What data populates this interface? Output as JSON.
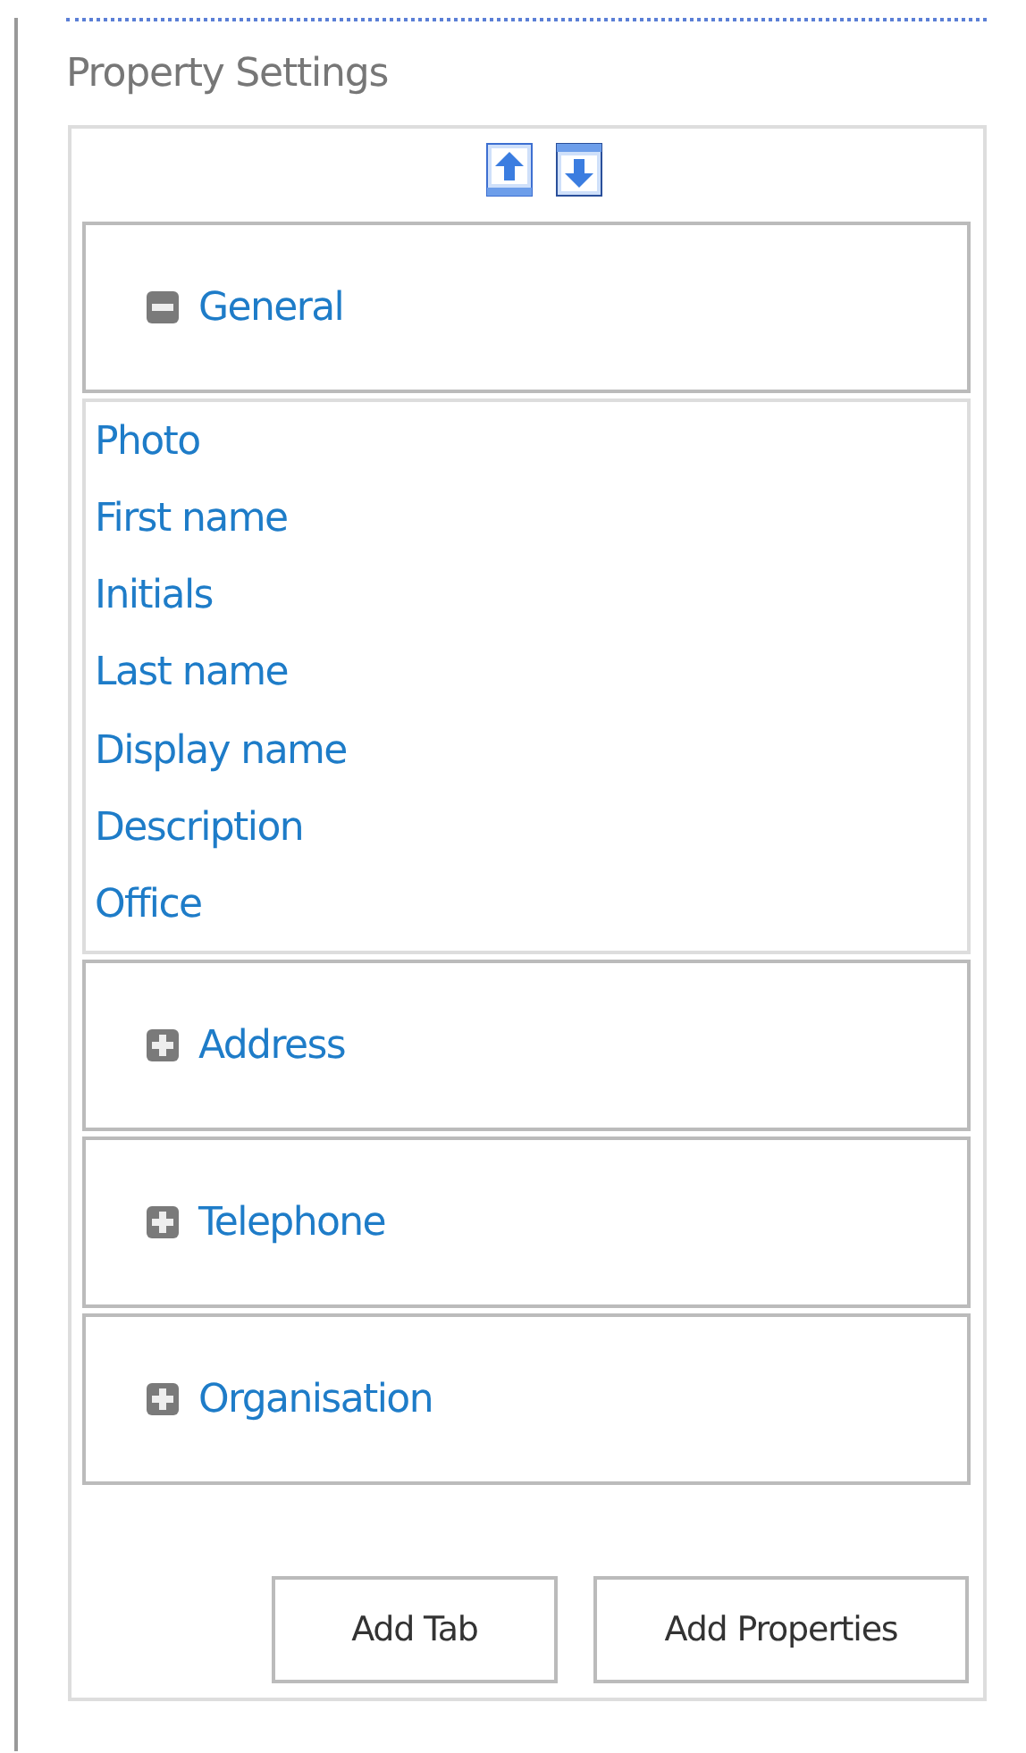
{
  "title": "Property Settings",
  "sections": [
    {
      "label": "General",
      "expanded": true,
      "fields": [
        "Photo",
        "First name",
        "Initials",
        "Last name",
        "Display name",
        "Description",
        "Office"
      ]
    },
    {
      "label": "Address",
      "expanded": false
    },
    {
      "label": "Telephone",
      "expanded": false
    },
    {
      "label": "Organisation",
      "expanded": false
    }
  ],
  "buttons": [
    "Add Tab",
    "Add Properties"
  ]
}
